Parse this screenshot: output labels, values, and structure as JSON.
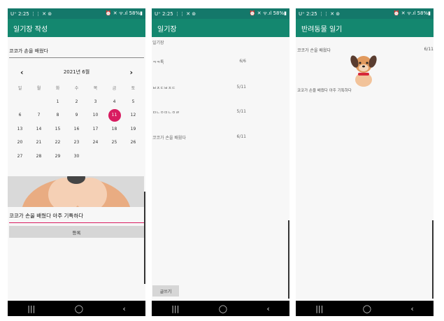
{
  "status": {
    "left": "U⁺ 2:25 ⋮⋮ ✕ ⊚",
    "right": "⏰ ✕ ᯤ.ıl 58%▮"
  },
  "screen1": {
    "appbar_title": "일기장 작성",
    "title_value": "코코가 손을 배웠다",
    "calendar": {
      "month_label": "2021년 6월",
      "weekdays": [
        "일",
        "월",
        "화",
        "수",
        "목",
        "금",
        "토"
      ],
      "days": [
        "",
        "",
        "1",
        "2",
        "3",
        "4",
        "5",
        "6",
        "7",
        "8",
        "9",
        "10",
        "11",
        "12",
        "13",
        "14",
        "15",
        "16",
        "17",
        "18",
        "19",
        "20",
        "21",
        "22",
        "23",
        "24",
        "25",
        "26",
        "27",
        "28",
        "29",
        "30",
        "",
        "",
        ""
      ],
      "selected_day": "11"
    },
    "content_value": "코코가 손을 배웠다 아주 기특하다",
    "register_button": "등록"
  },
  "screen2": {
    "appbar_title": "일기장",
    "entries": [
      {
        "title": "일기장",
        "date": ""
      },
      {
        "title": "ㅋㅋ톡",
        "date": "6/6"
      },
      {
        "title": "ㅂㅈㄷㅂㅈㄷ",
        "date": "5/11"
      },
      {
        "title": "ㅁㄴㅇㅁㄴㅇㄹ",
        "date": "5/11"
      },
      {
        "title": "코코가 손을 배웠다",
        "date": "6/11"
      }
    ],
    "write_button": "글쓰기"
  },
  "screen3": {
    "appbar_title": "반려동물 일기",
    "entry_title": "코코가 손을 배웠다",
    "entry_date": "6/11",
    "entry_body": "코코가 손을 배웠다 아주 기특하다"
  },
  "nav": {
    "recent": "|||",
    "home": "◯",
    "back": "‹"
  },
  "colors": {
    "status_bar": "#14786a",
    "app_bar": "#14876f",
    "accent": "#d81b60"
  }
}
